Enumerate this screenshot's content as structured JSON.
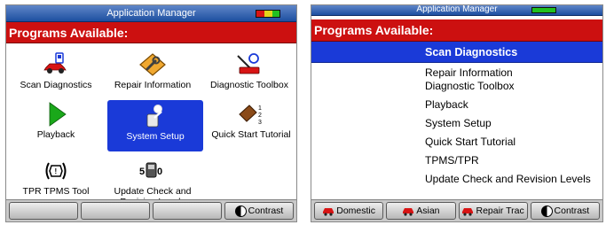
{
  "left": {
    "title": "Application Manager",
    "header": "Programs Available:",
    "apps": [
      {
        "label": "Scan Diagnostics",
        "icon": "car-scanner-icon"
      },
      {
        "label": "Repair Information",
        "icon": "wrench-book-icon"
      },
      {
        "label": "Diagnostic Toolbox",
        "icon": "toolbox-probe-icon"
      },
      {
        "label": "Playback",
        "icon": "play-icon"
      },
      {
        "label": "System Setup",
        "icon": "system-setup-icon",
        "selected": true
      },
      {
        "label": "Quick Start Tutorial",
        "icon": "tutorial-book-icon"
      },
      {
        "label": "TPR TPMS Tool",
        "icon": "tpms-icon"
      },
      {
        "label": "Update Check and Revision Levels",
        "icon": "update-icon"
      }
    ],
    "softkeys": [
      "",
      "",
      "",
      "Contrast"
    ]
  },
  "right": {
    "title": "Application Manager",
    "header": "Programs Available:",
    "items": [
      "Scan Diagnostics",
      "Repair Information",
      "Diagnostic Toolbox",
      "Playback",
      "System Setup",
      "Quick Start Tutorial",
      "TPMS/TPR",
      "Update Check and Revision Levels"
    ],
    "selected_index": 0,
    "softkeys": [
      "Domestic",
      "Asian",
      "Repair Trac",
      "Contrast"
    ]
  },
  "colors": {
    "titlebar": "#1d4fa0",
    "header": "#cc1010",
    "selection": "#1a3ad8",
    "battery_green": "#22c020"
  }
}
